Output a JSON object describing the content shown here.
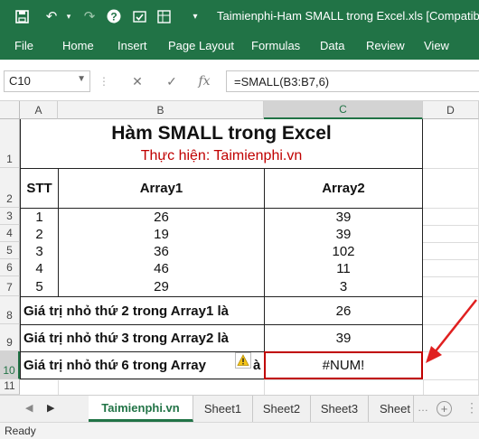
{
  "window": {
    "title": "Taimienphi-Ham SMALL trong Excel.xls  [Compatibility"
  },
  "quick_access": [
    "save-icon",
    "undo-icon",
    "redo-icon",
    "help-icon",
    "spellcheck-icon",
    "customize-icon"
  ],
  "ribbon": {
    "tabs": [
      "File",
      "Home",
      "Insert",
      "Page Layout",
      "Formulas",
      "Data",
      "Review",
      "View"
    ]
  },
  "formula_bar": {
    "name_box": "C10",
    "formula": "=SMALL(B3:B7,6)",
    "fx_label": "fx"
  },
  "columns": [
    "A",
    "B",
    "C",
    "D"
  ],
  "rows": [
    "1",
    "2",
    "3",
    "4",
    "5",
    "6",
    "7",
    "8",
    "9",
    "10",
    "11"
  ],
  "sheet": {
    "title": "Hàm SMALL trong Excel",
    "subtitle": "Thực hiện: Taimienphi.vn",
    "headers": {
      "stt": "STT",
      "array1": "Array1",
      "array2": "Array2"
    },
    "data_rows": [
      {
        "stt": "1",
        "array1": "26",
        "array2": "39"
      },
      {
        "stt": "2",
        "array1": "19",
        "array2": "39"
      },
      {
        "stt": "3",
        "array1": "36",
        "array2": "102"
      },
      {
        "stt": "4",
        "array1": "46",
        "array2": "11"
      },
      {
        "stt": "5",
        "array1": "29",
        "array2": "3"
      }
    ],
    "results": [
      {
        "label": "Giá trị nhỏ thứ 2 trong Array1 là",
        "value": "26"
      },
      {
        "label": "Giá trị nhỏ thứ 3 trong Array2 là",
        "value": "39"
      },
      {
        "label": "Giá trị nhỏ thứ 6 trong Array",
        "label_tail": "à",
        "value": "#NUM!"
      }
    ]
  },
  "sheet_tabs": [
    "Taimienphi.vn",
    "Sheet1",
    "Sheet2",
    "Sheet3",
    "Sheet"
  ],
  "status": {
    "text": "Ready"
  },
  "colors": {
    "accent": "#217346",
    "annotation": "#c00000"
  }
}
